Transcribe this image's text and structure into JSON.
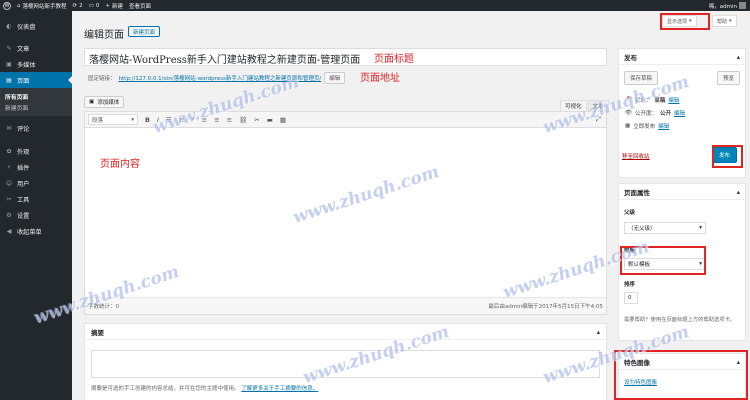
{
  "adminbar": {
    "site_name": "落樱网站新手教程",
    "updates": "2",
    "comments": "0",
    "new_label": "新建",
    "view_page": "查看页面",
    "greeting": "嗨，admin"
  },
  "sidebar": {
    "items": [
      {
        "label": "仪表盘",
        "icon": "dashboard-icon",
        "glyph": "◐"
      },
      {
        "label": "文章",
        "icon": "pin-icon",
        "glyph": "✎"
      },
      {
        "label": "多媒体",
        "icon": "media-icon",
        "glyph": "▣"
      },
      {
        "label": "页面",
        "icon": "page-icon",
        "glyph": "▤"
      },
      {
        "label": "评论",
        "icon": "comment-icon",
        "glyph": "✉"
      },
      {
        "label": "外观",
        "icon": "appearance-icon",
        "glyph": "✿"
      },
      {
        "label": "插件",
        "icon": "plugin-icon",
        "glyph": "⚡"
      },
      {
        "label": "用户",
        "icon": "user-icon",
        "glyph": "☺"
      },
      {
        "label": "工具",
        "icon": "tools-icon",
        "glyph": "✂"
      },
      {
        "label": "设置",
        "icon": "settings-icon",
        "glyph": "⚙"
      },
      {
        "label": "收起菜单",
        "icon": "collapse-icon",
        "glyph": "◀"
      }
    ],
    "submenu": [
      "所有页面",
      "新建页面"
    ]
  },
  "header": {
    "title": "编辑页面",
    "add_new": "新建页面",
    "screen_options": "显示选项",
    "help": "帮助"
  },
  "post": {
    "title": "落樱网站-WordPress新手入门建站教程之新建页面-管理页面",
    "permalink_label": "固定链接：",
    "permalink_url": "http://127.0.0.1/xin/落樱网站-wordpress新手入门建站教程之新建页面和管理页/",
    "permalink_edit": "编辑"
  },
  "editor": {
    "add_media": "添加媒体",
    "tab_visual": "可视化",
    "tab_text": "文本",
    "format": "段落",
    "word_count": "字数统计：0",
    "last_edited": "最后由admin编辑于2017年5月15日下午4:05"
  },
  "excerpt": {
    "title": "摘要",
    "desc": "摘要是可选的手工创建的内容总结，并可在您的主题中使用。",
    "link": "了解更多关于手工摘要的信息。"
  },
  "publish": {
    "title": "发布",
    "save_draft": "保存草稿",
    "preview": "预览",
    "status_label": "状态：",
    "status_value": "草稿",
    "visibility_label": "公开度：",
    "visibility_value": "公开",
    "schedule": "立即发布",
    "edit": "编辑",
    "trash": "移至回收站",
    "publish_btn": "发布"
  },
  "attributes": {
    "title": "页面属性",
    "parent_label": "父级",
    "parent_value": "（无父级）",
    "template_label": "模板",
    "template_value": "默认模板",
    "order_label": "排序",
    "order_value": "0",
    "help": "需要帮助？使用在页面标题上方的帮助选项卡。"
  },
  "thumbnail": {
    "title": "特色图像",
    "link": "设为特色图像"
  },
  "annotations": {
    "title_note": "页面标题",
    "url_note": "页面地址",
    "content_note": "页面内容"
  },
  "watermark": "www.zhuqh.com",
  "colors": {
    "accent": "#0073aa",
    "annotation": "#e02424",
    "adminbar": "#23282d"
  }
}
